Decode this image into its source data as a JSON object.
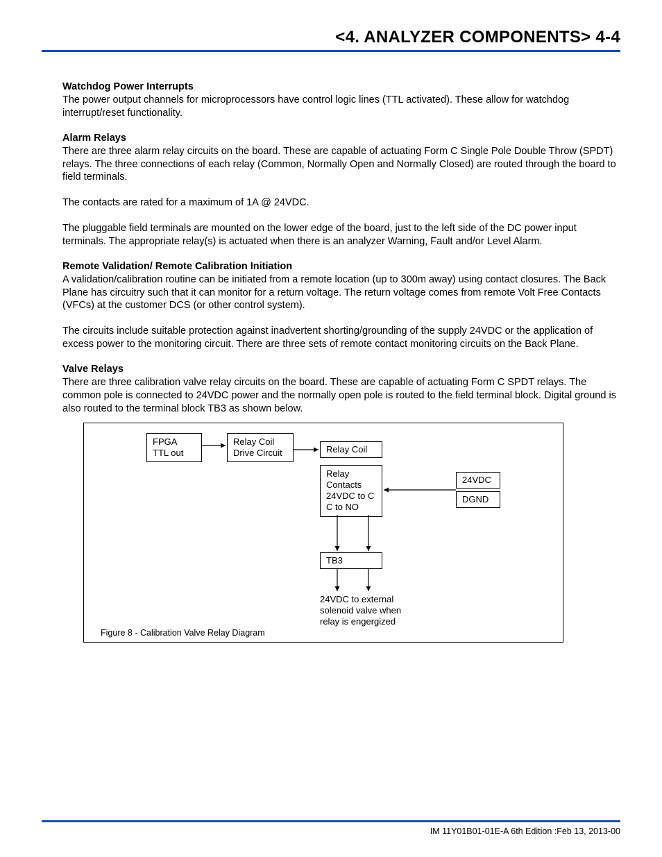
{
  "header": {
    "title": "<4. ANALYZER COMPONENTS>  4-4"
  },
  "sections": {
    "s1_head": "Watchdog Power Interrupts",
    "s1_p1": "The power output channels for microprocessors have control logic lines (TTL activated). These allow for watchdog interrupt/reset functionality.",
    "s2_head": "Alarm Relays",
    "s2_p1": "There are three alarm relay circuits on the board. These are capable of actuating Form C Single Pole Double Throw (SPDT) relays. The three connections of each relay (Common, Normally Open and Normally Closed) are routed through the board to field terminals.",
    "s2_p2": "The contacts are rated for a maximum of 1A @ 24VDC.",
    "s2_p3": "The pluggable field terminals are mounted on the lower edge of the board, just to the left side of the DC power input terminals. The appropriate relay(s) is actuated when there is an analyzer Warning, Fault and/or Level Alarm.",
    "s3_head": "Remote Validation/ Remote Calibration Initiation",
    "s3_p1": "A validation/calibration routine can be initiated from a remote location (up to 300m away) using contact closures. The Back Plane has circuitry such that it can monitor for a return voltage. The return voltage comes from remote Volt Free Contacts (VFCs) at the customer DCS (or other control system).",
    "s3_p2": "The circuits include suitable protection against inadvertent shorting/grounding of the supply 24VDC or the application of excess power to the monitoring circuit. There are three sets of remote contact monitoring circuits on the Back Plane.",
    "s4_head": "Valve Relays",
    "s4_p1": "There are three calibration valve relay circuits on the board. These are capable of actuating Form C SPDT relays. The common pole is connected to 24VDC power and the normally open pole is routed to the field terminal block. Digital ground is also routed to the terminal block TB3 as shown below."
  },
  "diagram": {
    "fpga": "FPGA\nTTL out",
    "relay_drive": "Relay Coil\nDrive Circuit",
    "relay_coil": "Relay Coil",
    "relay_contacts": "Relay\nContacts\n24VDC to C\nC to NO",
    "power1": "24VDC",
    "power2": "DGND",
    "tb3": "TB3",
    "out_label": "24VDC to external\nsolenoid valve when\nrelay is engergized",
    "caption": "Figure 8 - Calibration Valve Relay Diagram"
  },
  "footer": {
    "text": "IM 11Y01B01-01E-A    6th Edition :Feb 13, 2013-00"
  }
}
